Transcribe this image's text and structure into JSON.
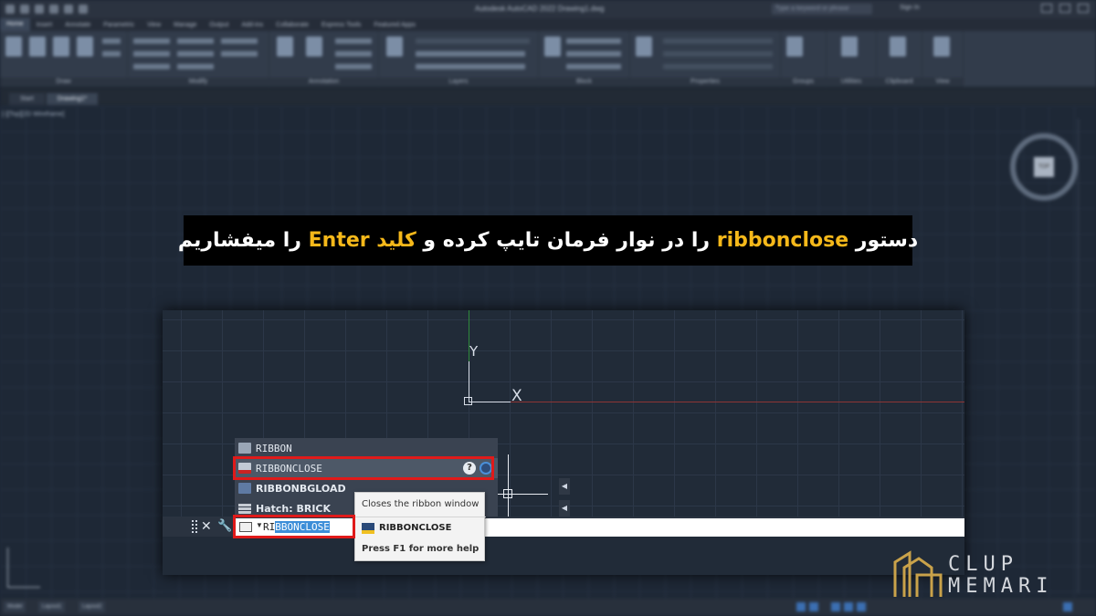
{
  "app": {
    "title": "Autodesk AutoCAD 2022   Drawing1.dwg",
    "search_placeholder": "Type a keyword or phrase",
    "sign_in": "Sign In"
  },
  "ribbon_tabs": [
    "Home",
    "Insert",
    "Annotate",
    "Parametric",
    "View",
    "Manage",
    "Output",
    "Add-ins",
    "Collaborate",
    "Express Tools",
    "Featured Apps"
  ],
  "ribbon_groups": [
    "Draw",
    "Modify",
    "Annotation",
    "Layers",
    "Block",
    "Properties",
    "Groups",
    "Utilities",
    "Clipboard",
    "View"
  ],
  "doc_tabs": [
    "Start",
    "Drawing1*"
  ],
  "viewport_label": "[-][Top][2D Wireframe]",
  "viewcube_face": "TOP",
  "layout_tabs": [
    "Model",
    "Layout1",
    "Layout2"
  ],
  "caption": {
    "part1": "دستور",
    "command": "ribbonclose",
    "part2": "را در نوار فرمان تایپ کرده و",
    "key_word": "کلید Enter",
    "part3": "را میفشاریم"
  },
  "zoom": {
    "ucs_y": "Y",
    "ucs_x": "X",
    "suggestions": [
      {
        "label": "RIBBON",
        "icon": "ribbon-icon"
      },
      {
        "label": "RIBBONCLOSE",
        "icon": "ribbon-close-icon"
      },
      {
        "label": "RIBBONBGLOAD",
        "icon": "lisp-icon"
      },
      {
        "label": "Hatch: BRICK",
        "icon": "hatch-brick-icon"
      }
    ],
    "command_typed": "RI",
    "command_autocomplete": "BBONCLOSE",
    "tooltip": {
      "description": "Closes the ribbon window",
      "command": "RIBBONCLOSE",
      "help": "Press F1 for more help"
    }
  },
  "watermark": {
    "line1": "CLUP",
    "line2": "MEMARI"
  },
  "colors": {
    "caption_highlight": "#f5b81a",
    "callout_red": "#e01a1a",
    "selection_blue": "#3d8ed8"
  }
}
